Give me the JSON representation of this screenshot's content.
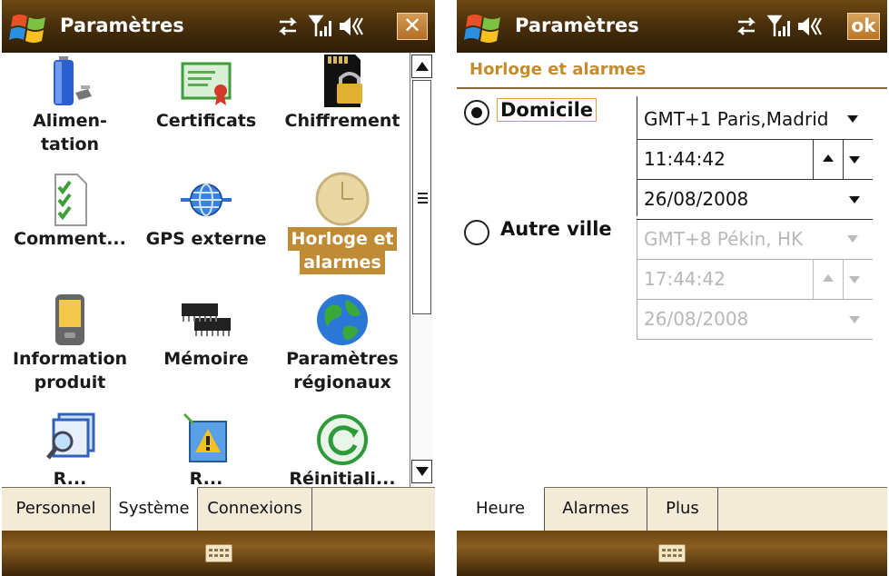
{
  "left": {
    "title": "Paramètres",
    "close_label": "✕",
    "items": [
      {
        "label1": "Alimen-",
        "label2": "tation",
        "icon": "battery-icon"
      },
      {
        "label1": "Certificats",
        "label2": "",
        "icon": "certificate-icon"
      },
      {
        "label1": "Chiffrement",
        "label2": "",
        "icon": "encryption-lock-icon"
      },
      {
        "label1": "Comment...",
        "label2": "",
        "icon": "checklist-icon"
      },
      {
        "label1": "GPS externe",
        "label2": "",
        "icon": "gps-globe-icon"
      },
      {
        "label1": "Horloge et",
        "label2": "alarmes",
        "icon": "clock-icon"
      },
      {
        "label1": "Information",
        "label2": "produit",
        "icon": "device-icon"
      },
      {
        "label1": "Mémoire",
        "label2": "",
        "icon": "memory-chip-icon"
      },
      {
        "label1": "Paramètres",
        "label2": "régionaux",
        "icon": "world-globe-icon"
      },
      {
        "label1": "R...",
        "label2": "",
        "icon": "task-manager-icon"
      },
      {
        "label1": "R...",
        "label2": "",
        "icon": "error-report-icon"
      },
      {
        "label1": "Réinitiali...",
        "label2": "",
        "icon": "reset-icon"
      }
    ],
    "tabs": [
      "Personnel",
      "Système",
      "Connexions"
    ],
    "active_tab": "Système"
  },
  "right": {
    "title": "Paramètres",
    "ok_label": "ok",
    "header": "Horloge et alarmes",
    "home": {
      "label": "Domicile",
      "timezone": "GMT+1 Paris,Madrid",
      "time": "11:44:42",
      "date": "26/08/2008"
    },
    "visiting": {
      "label": "Autre ville",
      "timezone": "GMT+8 Pékin, HK",
      "time": "17:44:42",
      "date": "26/08/2008"
    },
    "tabs": [
      "Heure",
      "Alarmes",
      "Plus"
    ],
    "active_tab": "Heure"
  },
  "colors": {
    "title_bar": "#4a300b",
    "accent": "#c08b35",
    "header_text": "#c58c2e",
    "disabled_text": "#b8b8b8"
  }
}
